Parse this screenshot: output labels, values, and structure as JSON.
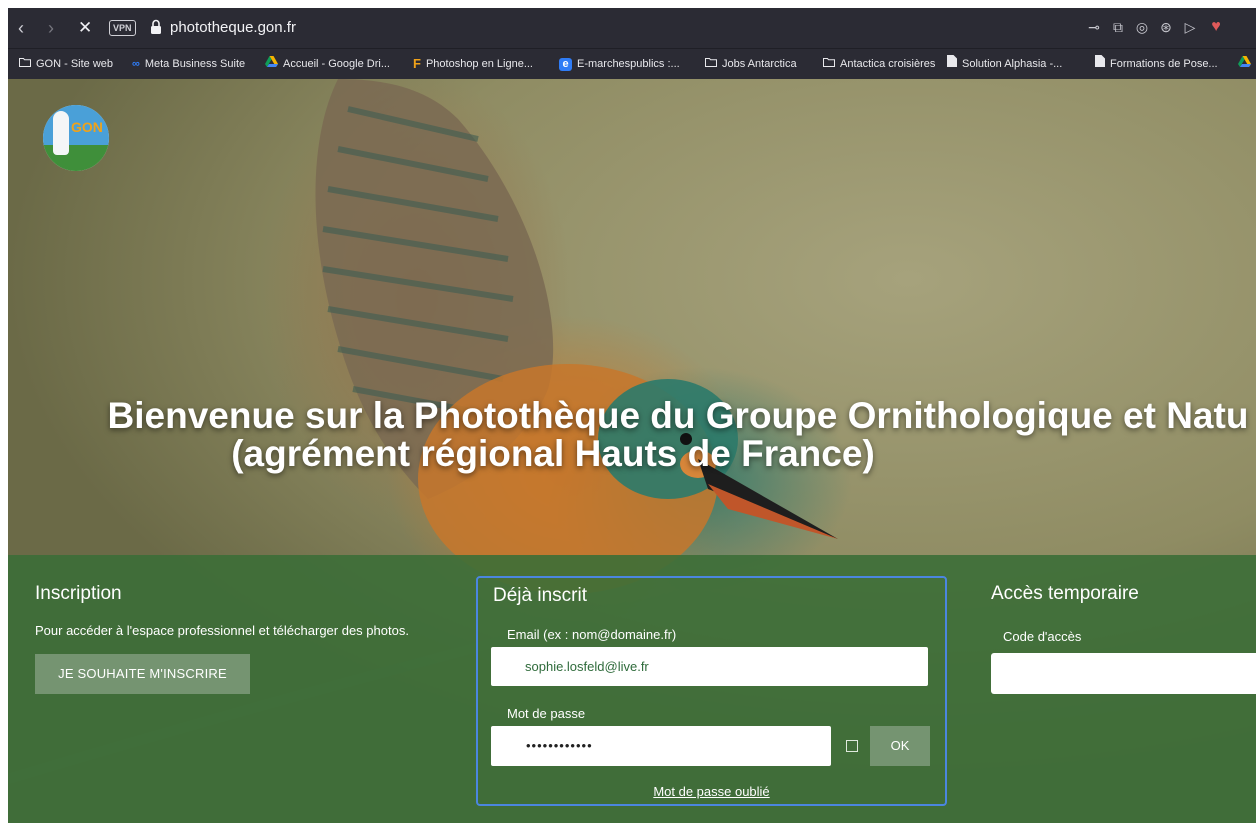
{
  "browser": {
    "url": "phototheque.gon.fr",
    "vpn_label": "VPN",
    "bookmarks": [
      {
        "label": "GON - Site web",
        "icon": "folder-icon"
      },
      {
        "label": "Meta Business Suite",
        "icon": "meta-icon"
      },
      {
        "label": "Accueil - Google Dri...",
        "icon": "drive-icon"
      },
      {
        "label": "Photoshop en Ligne...",
        "icon": "photoshop-icon"
      },
      {
        "label": "E-marchespublics :...",
        "icon": "e-icon"
      },
      {
        "label": "Jobs Antarctica",
        "icon": "folder-icon"
      },
      {
        "label": "Antactica croisières",
        "icon": "folder-icon"
      },
      {
        "label": "Solution Alphasia -...",
        "icon": "document-icon"
      },
      {
        "label": "Formations de Pose...",
        "icon": "document-icon"
      }
    ]
  },
  "page": {
    "logo_text": "GON",
    "title_line1": "Bienvenue sur la Photothèque du Groupe Ornithologique et Natu",
    "title_line2": "(agrément régional Hauts de France)"
  },
  "inscription": {
    "title": "Inscription",
    "description": "Pour accéder à l'espace professionnel et télécharger des photos.",
    "button": "JE SOUHAITE M'INSCRIRE"
  },
  "login": {
    "title": "Déjà inscrit",
    "email_label": "Email (ex : nom@domaine.fr)",
    "email_value": "sophie.losfeld@live.fr",
    "password_label": "Mot de passe",
    "password_value": "••••••••••••",
    "ok_button": "OK",
    "forgot_link": "Mot de passe oublié"
  },
  "temporary": {
    "title": "Accès temporaire",
    "code_label": "Code d'accès"
  },
  "colors": {
    "panel": "#3c6e37",
    "focus_border": "#4b86e0",
    "chrome": "#2b2b34",
    "heart": "#e05a5a"
  }
}
